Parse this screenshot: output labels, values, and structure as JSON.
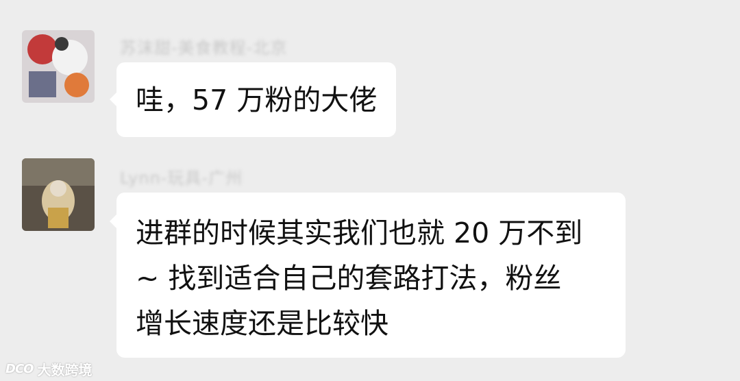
{
  "messages": [
    {
      "sender": "苏沫甜-美食教程-北京",
      "avatar_icon": "user-avatar-icon",
      "lines": [
        "哇，57 万粉的大佬"
      ]
    },
    {
      "sender": "Lynn-玩具-广州",
      "avatar_icon": "user-avatar-icon",
      "lines": [
        "进群的时候其实我们也就 20 万不到",
        "~ 找到适合自己的套路打法，粉丝",
        "增长速度还是比较快"
      ]
    }
  ],
  "watermark": {
    "logo": "DCO",
    "text": "大数跨境"
  },
  "colors": {
    "background": "#ededed",
    "bubble": "#ffffff",
    "sender_name": "#c9c9c9"
  }
}
